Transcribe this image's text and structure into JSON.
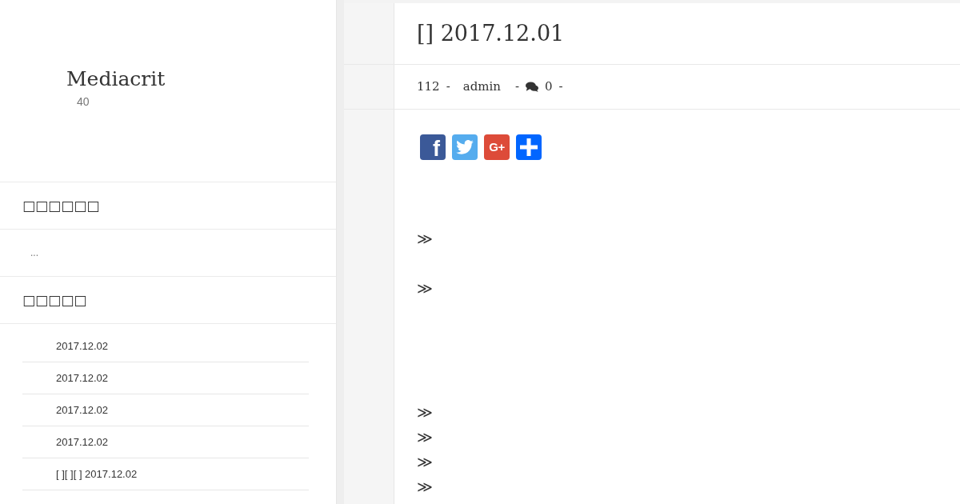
{
  "site": {
    "title": "Mediacrit",
    "tagline": "40"
  },
  "sidebar": {
    "widgets": [
      {
        "kind": "text",
        "heading": "□□□□□□",
        "body": "..."
      },
      {
        "kind": "list",
        "heading": "□□□□□",
        "items": [
          "2017.12.02",
          "2017.12.02",
          "2017.12.02",
          "2017.12.02",
          "[ ][ ][ ] 2017.12.02"
        ]
      }
    ]
  },
  "post": {
    "title": "[] 2017.12.01",
    "meta": [
      {
        "kind": "text",
        "text": "112"
      },
      {
        "kind": "separator",
        "text": "-"
      },
      {
        "kind": "author",
        "text": "admin"
      },
      {
        "kind": "separator",
        "text": "-"
      },
      {
        "kind": "comments",
        "text": "0"
      },
      {
        "kind": "separator",
        "text": "-"
      }
    ],
    "share_buttons": [
      {
        "kind": "facebook",
        "glyph": "f"
      },
      {
        "kind": "twitter"
      },
      {
        "kind": "google_plus",
        "glyph": "G+"
      },
      {
        "kind": "share"
      }
    ],
    "body": [
      {
        "lines": [
          "≫"
        ]
      },
      {
        "lines": [
          "≫"
        ]
      },
      {
        "lines": [
          "≫",
          "≫",
          "≫",
          "≫"
        ]
      }
    ]
  }
}
